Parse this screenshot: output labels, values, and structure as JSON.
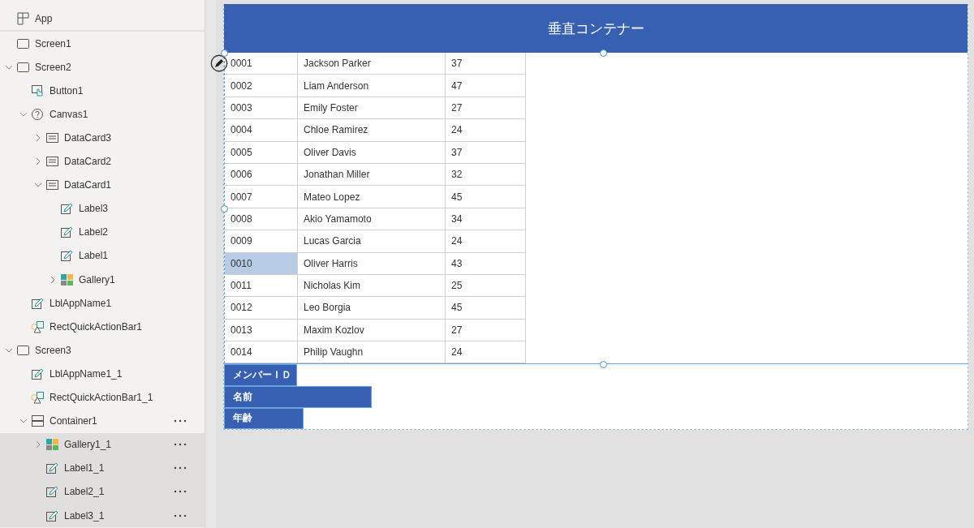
{
  "tree": [
    {
      "label": "App",
      "kind": "app",
      "selected": false,
      "menu": false
    },
    {
      "label": "Screen1",
      "kind": "screen",
      "selected": false,
      "menu": false
    },
    {
      "label": "Screen2",
      "kind": "screen",
      "expanded": true,
      "selected": false,
      "menu": false,
      "children": [
        {
          "label": "Button1",
          "kind": "button",
          "selected": false,
          "menu": false
        },
        {
          "label": "Canvas1",
          "kind": "canvas",
          "expanded": true,
          "selected": false,
          "menu": false,
          "children": [
            {
              "label": "DataCard3",
              "kind": "datacard",
              "expanded": false,
              "selected": false,
              "menu": false
            },
            {
              "label": "DataCard2",
              "kind": "datacard",
              "expanded": false,
              "selected": false,
              "menu": false
            },
            {
              "label": "DataCard1",
              "kind": "datacard",
              "expanded": true,
              "selected": false,
              "menu": false,
              "children": [
                {
                  "label": "Label3",
                  "kind": "label",
                  "selected": false,
                  "menu": false
                },
                {
                  "label": "Label2",
                  "kind": "label",
                  "selected": false,
                  "menu": false
                },
                {
                  "label": "Label1",
                  "kind": "label",
                  "selected": false,
                  "menu": false
                },
                {
                  "label": "Gallery1",
                  "kind": "gallery",
                  "expanded": false,
                  "selected": false,
                  "menu": false
                }
              ]
            }
          ]
        },
        {
          "label": "LblAppName1",
          "kind": "label",
          "selected": false,
          "menu": false
        },
        {
          "label": "RectQuickActionBar1",
          "kind": "rect",
          "selected": false,
          "menu": false
        }
      ]
    },
    {
      "label": "Screen3",
      "kind": "screen",
      "expanded": true,
      "selected": false,
      "menu": false,
      "children": [
        {
          "label": "LblAppName1_1",
          "kind": "label",
          "selected": false,
          "menu": false
        },
        {
          "label": "RectQuickActionBar1_1",
          "kind": "rect",
          "selected": false,
          "menu": false
        },
        {
          "label": "Container1",
          "kind": "container",
          "expanded": true,
          "selected": false,
          "menu": true,
          "children": [
            {
              "label": "Gallery1_1",
              "kind": "gallery",
              "expanded": false,
              "selected": true,
              "menu": true
            },
            {
              "label": "Label1_1",
              "kind": "label",
              "selected": true,
              "menu": true
            },
            {
              "label": "Label2_1",
              "kind": "label",
              "selected": true,
              "menu": true
            },
            {
              "label": "Label3_1",
              "kind": "label",
              "selected": true,
              "menu": true
            }
          ]
        }
      ]
    }
  ],
  "container": {
    "title": "垂直コンテナー",
    "rows": [
      {
        "id": "0001",
        "name": "Jackson Parker",
        "age": "37",
        "selected": false
      },
      {
        "id": "0002",
        "name": "Liam Anderson",
        "age": "47",
        "selected": false
      },
      {
        "id": "0003",
        "name": "Emily Foster",
        "age": "27",
        "selected": false
      },
      {
        "id": "0004",
        "name": "Chloe Ramirez",
        "age": "24",
        "selected": false
      },
      {
        "id": "0005",
        "name": "Oliver Davis",
        "age": "37",
        "selected": false
      },
      {
        "id": "0006",
        "name": "Jonathan Miller",
        "age": "32",
        "selected": false
      },
      {
        "id": "0007",
        "name": "Mateo Lopez",
        "age": "45",
        "selected": false
      },
      {
        "id": "0008",
        "name": "Akio Yamamoto",
        "age": "34",
        "selected": false
      },
      {
        "id": "0009",
        "name": "Lucas Garcia",
        "age": "24",
        "selected": false
      },
      {
        "id": "0010",
        "name": "Oliver Harris",
        "age": "43",
        "selected": true
      },
      {
        "id": "0011",
        "name": "Nicholas Kim",
        "age": "25",
        "selected": false
      },
      {
        "id": "0012",
        "name": "Leo Borgia",
        "age": "45",
        "selected": false
      },
      {
        "id": "0013",
        "name": "Maxim Kozlov",
        "age": "27",
        "selected": false
      },
      {
        "id": "0014",
        "name": "Philip Vaughn",
        "age": "24",
        "selected": false
      }
    ],
    "labels": [
      "メンバーＩＤ",
      "名前",
      "年齢"
    ]
  }
}
